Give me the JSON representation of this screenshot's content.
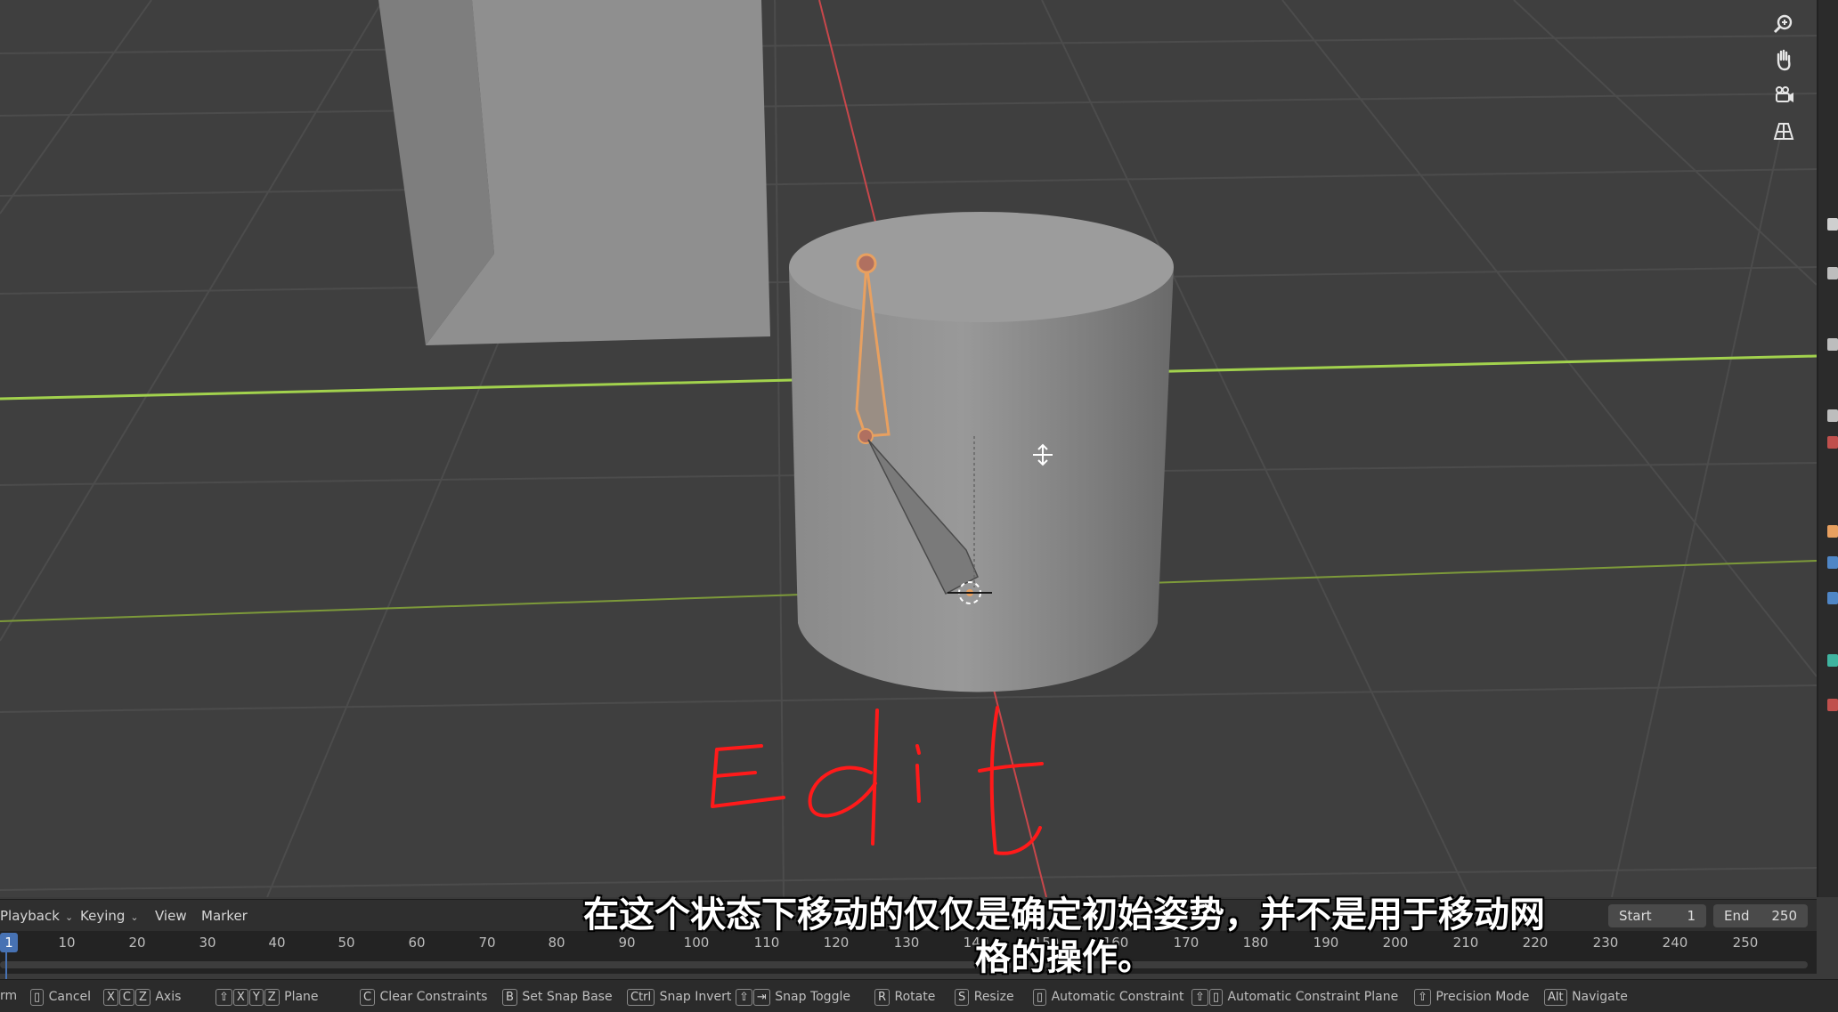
{
  "viewport": {
    "annotation_text": "Edit",
    "navigation": [
      "zoom-icon",
      "hand-pan-icon",
      "camera-icon",
      "grid-perspective-icon"
    ],
    "colors": {
      "background": "#404040",
      "x_axis": "#c8474b",
      "y_axis": "#a2d24d",
      "bone_selected": "#e8a060",
      "annotation": "#ff1a1a"
    }
  },
  "timeline": {
    "menus": [
      {
        "label": "Playback",
        "has_dropdown": true
      },
      {
        "label": "Keying",
        "has_dropdown": true
      },
      {
        "label": "View",
        "has_dropdown": false
      },
      {
        "label": "Marker",
        "has_dropdown": false
      }
    ],
    "current_frame": "1",
    "start_label": "Start",
    "start_value": "1",
    "end_label": "End",
    "end_value": "250",
    "ticks": [
      "10",
      "20",
      "30",
      "40",
      "50",
      "60",
      "70",
      "80",
      "90",
      "100",
      "110",
      "120",
      "130",
      "140",
      "150",
      "160",
      "170",
      "180",
      "190",
      "200",
      "210",
      "220",
      "230",
      "240",
      "250"
    ]
  },
  "status_bar": {
    "items": [
      {
        "keys": [],
        "label": "rm"
      },
      {
        "keys": [
          "mouse-right-icon"
        ],
        "label": "Cancel"
      },
      {
        "keys": [
          "X",
          "C",
          "Z"
        ],
        "label": "Axis"
      },
      {
        "keys": [
          "shift-icon",
          "X",
          "Y",
          "Z"
        ],
        "label": "Plane"
      },
      {
        "keys": [
          "C"
        ],
        "label": "Clear Constraints"
      },
      {
        "keys": [
          "B"
        ],
        "label": "Set Snap Base"
      },
      {
        "keys": [
          "Ctrl"
        ],
        "label": "Snap Invert"
      },
      {
        "keys": [
          "shift-icon",
          "tab-icon"
        ],
        "label": "Snap Toggle"
      },
      {
        "keys": [
          "R"
        ],
        "label": "Rotate"
      },
      {
        "keys": [
          "S"
        ],
        "label": "Resize"
      },
      {
        "keys": [
          "mouse-middle-icon"
        ],
        "label": "Automatic Constraint"
      },
      {
        "keys": [
          "shift-icon",
          "mouse-middle-icon"
        ],
        "label": "Automatic Constraint Plane"
      },
      {
        "keys": [
          "shift-icon"
        ],
        "label": "Precision Mode"
      },
      {
        "keys": [
          "Alt"
        ],
        "label": "Navigate"
      }
    ]
  },
  "subtitle": {
    "line1": "在这个状态下移动的仅仅是确定初始姿势，并不是用于移动网",
    "line2": "格的操作。"
  }
}
